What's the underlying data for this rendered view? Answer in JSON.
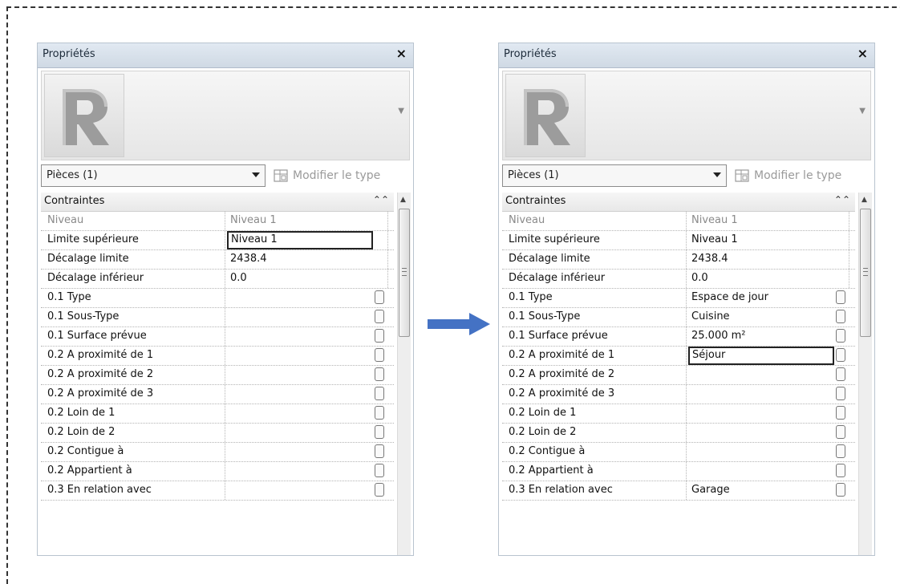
{
  "panels": [
    {
      "title": "Propriétés",
      "close": "×",
      "type_selector": "Pièces (1)",
      "edit_type": "Modifier le type",
      "group": "Contraintes",
      "rows": [
        {
          "name": "Niveau",
          "value": "Niveau 1"
        },
        {
          "name": "Limite supérieure",
          "value": "Niveau 1"
        },
        {
          "name": "Décalage limite",
          "value": "2438.4"
        },
        {
          "name": "Décalage inférieur",
          "value": "0.0"
        },
        {
          "name": "0.1 Type",
          "value": ""
        },
        {
          "name": "0.1 Sous-Type",
          "value": ""
        },
        {
          "name": "0.1 Surface prévue",
          "value": ""
        },
        {
          "name": "0.2 A proximité de 1",
          "value": ""
        },
        {
          "name": "0.2 A proximité de 2",
          "value": ""
        },
        {
          "name": "0.2 A proximité de 3",
          "value": ""
        },
        {
          "name": "0.2 Loin de 1",
          "value": ""
        },
        {
          "name": "0.2 Loin de 2",
          "value": ""
        },
        {
          "name": "0.2 Contigue à",
          "value": ""
        },
        {
          "name": "0.2 Appartient à",
          "value": ""
        },
        {
          "name": "0.3 En relation avec",
          "value": ""
        }
      ]
    },
    {
      "title": "Propriétés",
      "close": "×",
      "type_selector": "Pièces (1)",
      "edit_type": "Modifier le type",
      "group": "Contraintes",
      "rows": [
        {
          "name": "Niveau",
          "value": "Niveau 1"
        },
        {
          "name": "Limite supérieure",
          "value": "Niveau 1"
        },
        {
          "name": "Décalage limite",
          "value": "2438.4"
        },
        {
          "name": "Décalage inférieur",
          "value": "0.0"
        },
        {
          "name": "0.1 Type",
          "value": "Espace de jour"
        },
        {
          "name": "0.1 Sous-Type",
          "value": "Cuisine"
        },
        {
          "name": "0.1 Surface prévue",
          "value": "25.000 m²"
        },
        {
          "name": "0.2 A proximité de 1",
          "value": "Séjour"
        },
        {
          "name": "0.2 A proximité de 2",
          "value": ""
        },
        {
          "name": "0.2 A proximité de 3",
          "value": ""
        },
        {
          "name": "0.2 Loin de 1",
          "value": ""
        },
        {
          "name": "0.2 Loin de 2",
          "value": ""
        },
        {
          "name": "0.2 Contigue à",
          "value": ""
        },
        {
          "name": "0.2 Appartient à",
          "value": ""
        },
        {
          "name": "0.3 En relation avec",
          "value": "Garage"
        }
      ]
    }
  ],
  "icons": {
    "logo": "revit-logo-icon",
    "edit_type": "edit-type-icon",
    "arrow": "right-arrow-icon"
  },
  "colors": {
    "arrow": "#4472c4",
    "header": "#d6e0eb"
  }
}
